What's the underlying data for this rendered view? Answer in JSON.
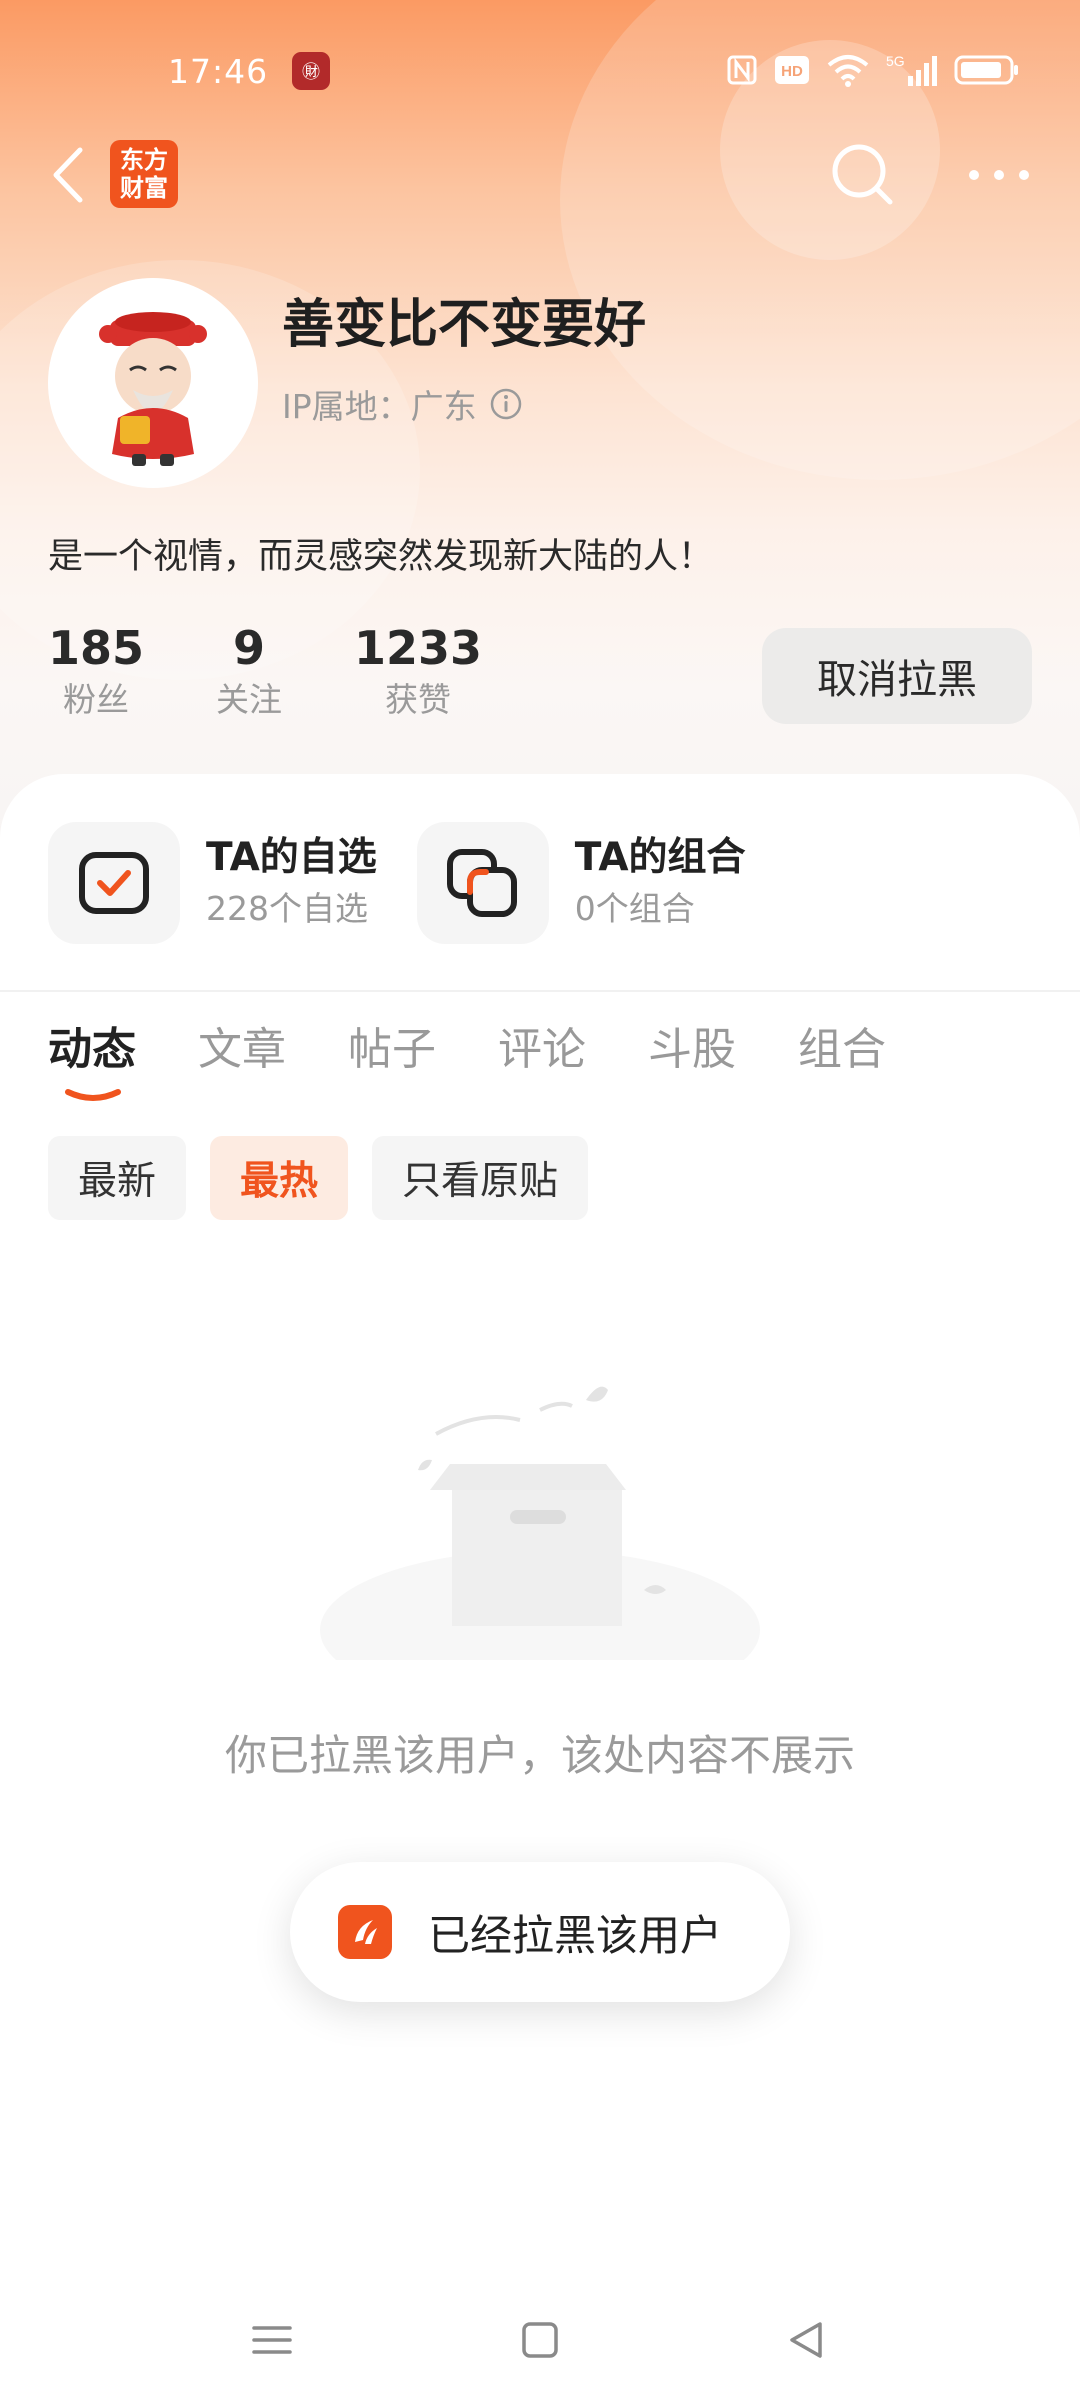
{
  "status_bar": {
    "time": "17:46",
    "app_icon_glyph": "㊖",
    "icons": [
      "nfc-icon",
      "hd-icon",
      "wifi-icon",
      "signal-5g-icon",
      "battery-icon"
    ],
    "network_label": "5G",
    "hd_label": "HD"
  },
  "nav": {
    "brand_line1": "东方",
    "brand_line2": "财富"
  },
  "profile": {
    "name": "善变比不变要好",
    "ip_location": "IP属地：广东",
    "bio": "是一个视情，而灵感突然发现新大陆的人！"
  },
  "stats": [
    {
      "value": "185",
      "label": "粉丝"
    },
    {
      "value": "9",
      "label": "关注"
    },
    {
      "value": "1233",
      "label": "获赞"
    }
  ],
  "unblock_button": "取消拉黑",
  "quick_links": [
    {
      "title": "TA的自选",
      "subtitle": "228个自选"
    },
    {
      "title": "TA的组合",
      "subtitle": "0个组合"
    }
  ],
  "tabs": [
    "动态",
    "文章",
    "帖子",
    "评论",
    "斗股",
    "组合"
  ],
  "active_tab": "动态",
  "filters": [
    "最新",
    "最热",
    "只看原贴"
  ],
  "active_filter": "最热",
  "empty_message": "你已拉黑该用户，该处内容不展示",
  "toast_message": "已经拉黑该用户",
  "colors": {
    "accent": "#f0541e",
    "header_top": "#fb9a63",
    "muted_text": "#9a9a9a"
  }
}
